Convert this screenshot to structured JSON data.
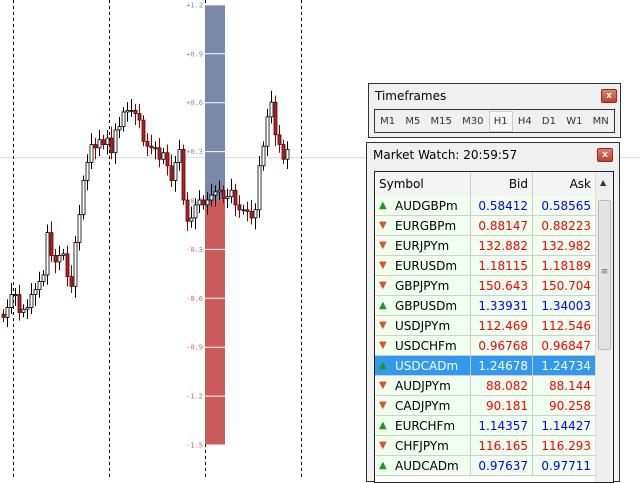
{
  "chart": {
    "bar_indicator": {
      "up_value": 1.2,
      "down_value": -1.5,
      "up_color": "#7a88aa",
      "down_color": "#cc5c5c"
    },
    "axis_ticks": [
      "+1.2",
      "+0.9",
      "+0.6",
      "+0.3",
      "0.0",
      "-0.3",
      "-0.6",
      "-0.9",
      "-1.2",
      "-1.5"
    ],
    "tick_values": [
      1.2,
      0.9,
      0.6,
      0.3,
      0,
      -0.3,
      -0.6,
      -0.9,
      -1.2,
      -1.5
    ],
    "first_open": -0.7,
    "closes": [
      -0.72,
      -0.66,
      -0.58,
      -0.58,
      -0.69,
      -0.67,
      -0.66,
      -0.58,
      -0.55,
      -0.5,
      -0.46,
      -0.2,
      -0.34,
      -0.38,
      -0.34,
      -0.33,
      -0.47,
      -0.53,
      -0.26,
      -0.09,
      0.12,
      0.23,
      0.34,
      0.32,
      0.37,
      0.34,
      0.38,
      0.29,
      0.43,
      0.45,
      0.54,
      0.55,
      0.55,
      0.53,
      0.49,
      0.36,
      0.33,
      0.32,
      0.32,
      0.25,
      0.29,
      0.21,
      0.12,
      0.23,
      0.31,
      0.0,
      -0.13,
      -0.11,
      -0.03,
      0.0,
      -0.03,
      0.0,
      0.03,
      0.05,
      0.06,
      0.01,
      0.02,
      0.06,
      -0.03,
      -0.06,
      -0.06,
      -0.07,
      -0.11,
      -0.06,
      0.21,
      0.33,
      0.51,
      0.6,
      0.4,
      0.34,
      0.25,
      0.31
    ],
    "price_line": 0.26
  },
  "timeframes": {
    "title": "Timeframes",
    "items": [
      "M1",
      "M5",
      "M15",
      "M30",
      "H1",
      "H4",
      "D1",
      "W1",
      "MN"
    ],
    "active": "H1"
  },
  "market_watch": {
    "title": "Market Watch: 20:59:57",
    "headers": {
      "symbol": "Symbol",
      "bid": "Bid",
      "ask": "Ask"
    },
    "rows": [
      {
        "symbol": "AUDGBPm",
        "bid": "0.58412",
        "ask": "0.58565",
        "dir": "up"
      },
      {
        "symbol": "EURGBPm",
        "bid": "0.88147",
        "ask": "0.88223",
        "dir": "down"
      },
      {
        "symbol": "EURJPYm",
        "bid": "132.882",
        "ask": "132.982",
        "dir": "down"
      },
      {
        "symbol": "EURUSDm",
        "bid": "1.18115",
        "ask": "1.18189",
        "dir": "down"
      },
      {
        "symbol": "GBPJPYm",
        "bid": "150.643",
        "ask": "150.704",
        "dir": "down"
      },
      {
        "symbol": "GBPUSDm",
        "bid": "1.33931",
        "ask": "1.34003",
        "dir": "up"
      },
      {
        "symbol": "USDJPYm",
        "bid": "112.469",
        "ask": "112.546",
        "dir": "down"
      },
      {
        "symbol": "USDCHFm",
        "bid": "0.96768",
        "ask": "0.96847",
        "dir": "down"
      },
      {
        "symbol": "USDCADm",
        "bid": "1.24678",
        "ask": "1.24734",
        "dir": "up",
        "selected": true
      },
      {
        "symbol": "AUDJPYm",
        "bid": "88.082",
        "ask": "88.144",
        "dir": "down"
      },
      {
        "symbol": "CADJPYm",
        "bid": "90.181",
        "ask": "90.258",
        "dir": "down"
      },
      {
        "symbol": "EURCHFm",
        "bid": "1.14357",
        "ask": "1.14427",
        "dir": "up"
      },
      {
        "symbol": "CHFJPYm",
        "bid": "116.165",
        "ask": "116.293",
        "dir": "down"
      },
      {
        "symbol": "AUDCADm",
        "bid": "0.97637",
        "ask": "0.97711",
        "dir": "up"
      }
    ]
  }
}
